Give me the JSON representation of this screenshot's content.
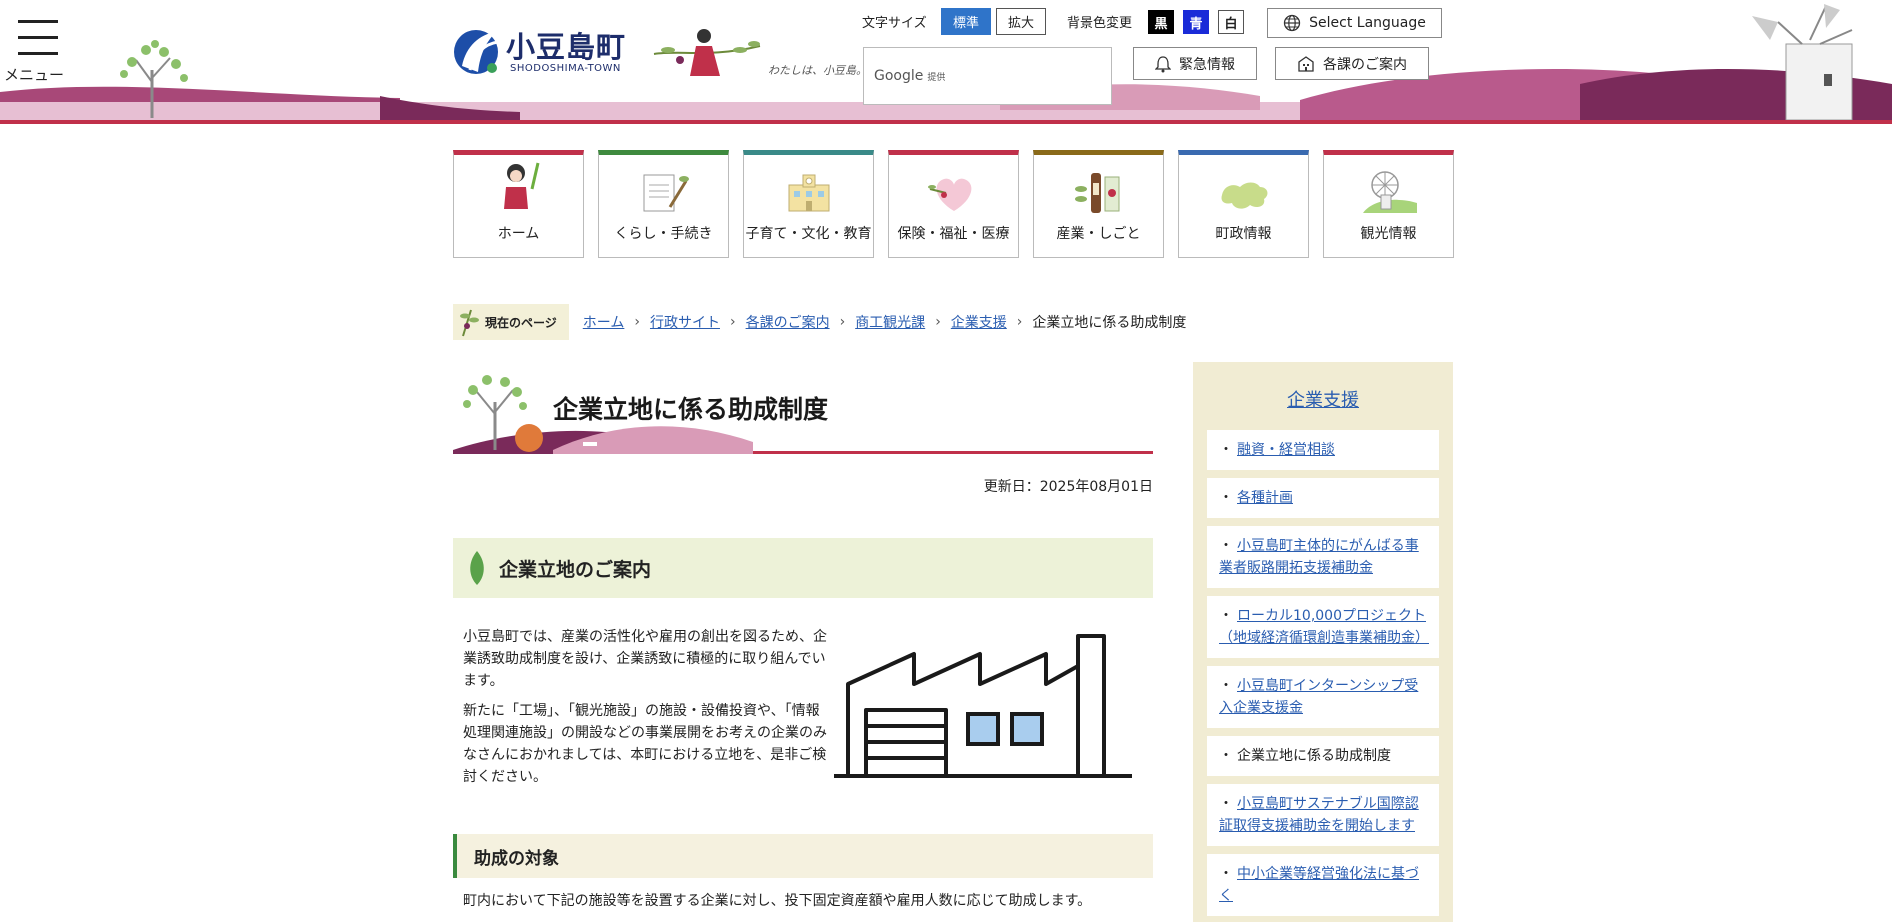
{
  "header": {
    "menu_label": "メニュー",
    "logo_jp": "小豆島町",
    "logo_en": "SHODOSHIMA-TOWN",
    "tagline": "わたしは、小豆島。",
    "font_size_label": "文字サイズ",
    "font_size_standard": "標準",
    "font_size_large": "拡大",
    "bg_color_label": "背景色変更",
    "bg_black": "黒",
    "bg_blue": "青",
    "bg_white": "白",
    "select_language": "Select Language",
    "search_provider": "Google",
    "search_provider_suffix": "提供",
    "emergency": "緊急情報",
    "departments": "各課のご案内"
  },
  "nav": [
    {
      "label": "ホーム",
      "color": "#c0304a"
    },
    {
      "label": "くらし・手続き",
      "color": "#3e8a3e"
    },
    {
      "label": "子育て・文化・教育",
      "color": "#3a8a88"
    },
    {
      "label": "保険・福祉・医療",
      "color": "#c0304a"
    },
    {
      "label": "産業・しごと",
      "color": "#8a6a1a"
    },
    {
      "label": "町政情報",
      "color": "#3a6ab0"
    },
    {
      "label": "観光情報",
      "color": "#c0304a"
    }
  ],
  "breadcrumb": {
    "tag": "現在のページ",
    "items": [
      "ホーム",
      "行政サイト",
      "各課のご案内",
      "商工観光課",
      "企業支援"
    ],
    "current": "企業立地に係る助成制度"
  },
  "main": {
    "title": "企業立地に係る助成制度",
    "updated": "更新日：2025年08月01日",
    "section_title": "企業立地のご案内",
    "para1": "小豆島町では、産業の活性化や雇用の創出を図るため、企業誘致助成制度を設け、企業誘致に積極的に取り組んでいます。",
    "para2": "新たに「工場」、「観光施設」の施設・設備投資や、「情報処理関連施設」の開設などの事業展開をお考えの企業のみなさんにおかれましては、本町における立地を、是非ご検討ください。",
    "subsection_title": "助成の対象",
    "body": "町内において下記の施設等を設置する企業に対し、投下固定資産額や雇用人数に応じて助成します。"
  },
  "sidebar": {
    "title": "企業支援",
    "items": [
      "融資・経営相談",
      "各種計画",
      "小豆島町主体的にがんばる事業者販路開拓支援補助金",
      "ローカル10,000プロジェクト（地域経済循環創造事業補助金）",
      "小豆島町インターンシップ受入企業支援金",
      "企業立地に係る助成制度",
      "小豆島町サステナブル国際認証取得支援補助金を開始します",
      "中小企業等経営強化法に基づく"
    ]
  },
  "colors": {
    "accent_red": "#c0304a",
    "link": "#2a5db0",
    "active_blue": "#2f74c9"
  }
}
